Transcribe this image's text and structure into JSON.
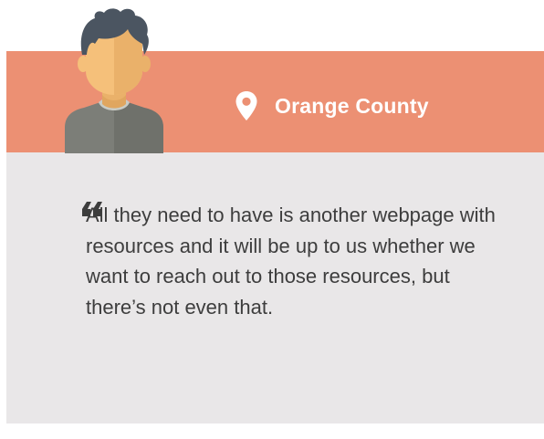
{
  "location": {
    "name": "Orange County",
    "icon": "location-pin-icon"
  },
  "avatar": {
    "icon": "person-avatar-icon"
  },
  "quote": {
    "icon": "quote-open-icon",
    "text": "All they need to have is another webpage with resources and it will be up to us whether we want to reach out to those resources, but there’s not even that."
  },
  "colors": {
    "banner": "#ec9073",
    "panel": "#e9e7e8",
    "text": "#3d3d3d",
    "hair": "#4b5561",
    "skin": "#f5c07a",
    "shirt": "#7c7e78"
  }
}
